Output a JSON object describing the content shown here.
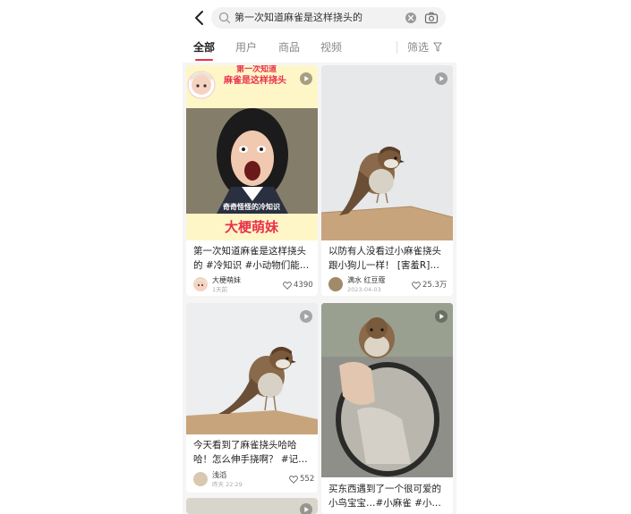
{
  "search": {
    "query": "第一次知道麻雀是这样挠头的"
  },
  "tabs": [
    {
      "label": "全部"
    },
    {
      "label": "用户"
    },
    {
      "label": "商品"
    },
    {
      "label": "视频"
    }
  ],
  "filter_label": "筛选",
  "accent_color": "#e8314d",
  "cards": [
    {
      "title_line1": "第一次知道麻雀是这样挠头",
      "title_line2": "的 #冷知识 #小动物们能…",
      "author": "大梗萌妹",
      "date": "1天前",
      "likes": "4390",
      "banner_line1": "第一次知道",
      "banner_line2": "麻雀是这样挠头",
      "caption": "奇奇怪怪的冷知识",
      "tag": "大梗萌妹"
    },
    {
      "title_line1": "以防有人没看过小麻雀挠头",
      "title_line2": "跟小狗儿一样！ [害羞R]…",
      "author": "满水 红豆蔻",
      "date": "2023-04-03",
      "likes": "25.3万"
    },
    {
      "title_line1": "今天看到了麻雀挠头哈哈",
      "title_line2": "哈！怎么伸手挠啊？ #记…",
      "author": "浅滔",
      "date": "昨天 22:29",
      "likes": "552"
    },
    {
      "title_line1": "买东西遇到了一个很可爱的",
      "title_line2": "小鸟宝宝…#小麻雀 #小…"
    }
  ]
}
